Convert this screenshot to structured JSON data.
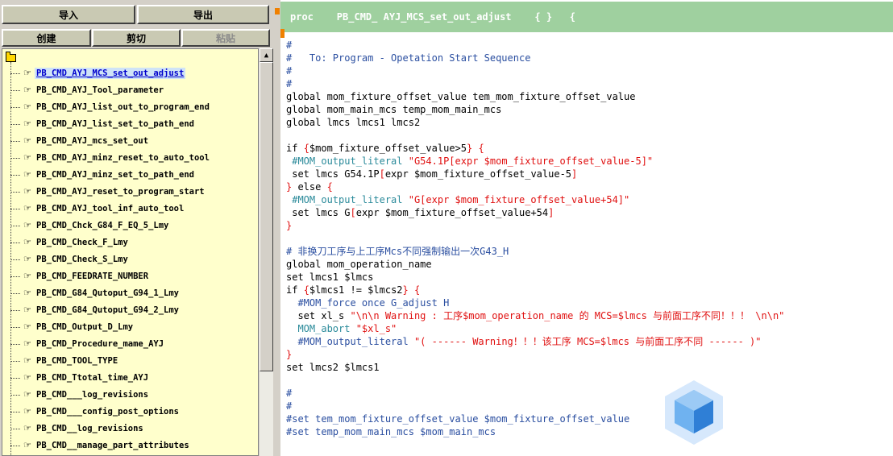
{
  "toolbar": {
    "import_label": "导入",
    "export_label": "导出",
    "create_label": "创建",
    "cut_label": "剪切",
    "paste_label": "粘贴"
  },
  "tree": {
    "items": [
      "PB_CMD_AYJ_MCS_set_out_adjust",
      "PB_CMD_AYJ_Tool_parameter",
      "PB_CMD_AYJ_list_out_to_program_end",
      "PB_CMD_AYJ_list_set_to_path_end",
      "PB_CMD_AYJ_mcs_set_out",
      "PB_CMD_AYJ_minz_reset_to_auto_tool",
      "PB_CMD_AYJ_minz_set_to_path_end",
      "PB_CMD_AYJ_reset_to_program_start",
      "PB_CMD_AYJ_tool_inf_auto_tool",
      "PB_CMD_Chck_G84_F_EQ_5_Lmy",
      "PB_CMD_Check_F_Lmy",
      "PB_CMD_Check_S_Lmy",
      "PB_CMD_FEEDRATE_NUMBER",
      "PB_CMD_G84_Qutoput_G94_1_Lmy",
      "PB_CMD_G84_Qutoput_G94_2_Lmy",
      "PB_CMD_Output_D_Lmy",
      "PB_CMD_Procedure_mame_AYJ",
      "PB_CMD_TOOL_TYPE",
      "PB_CMD_Ttotal_time_AYJ",
      "PB_CMD___log_revisions",
      "PB_CMD___config_post_options",
      "PB_CMD__log_revisions",
      "PB_CMD__manage_part_attributes"
    ],
    "selected_index": 0,
    "item_icon": "hand-pointer-icon"
  },
  "header": {
    "text": "proc    PB_CMD_ AYJ_MCS_set_out_adjust    { }   {"
  },
  "code": {
    "lines": [
      {
        "t": "#",
        "c": "cm"
      },
      {
        "t": "#   To: Program - Opetation Start Sequence",
        "c": "cm"
      },
      {
        "t": "#",
        "c": "cm"
      },
      {
        "t": "#",
        "c": "cm"
      },
      {
        "t": "global mom_fixture_offset_value tem_mom_fixture_offset_value",
        "c": "kw"
      },
      {
        "t": "global mom_main_mcs temp_mom_main_mcs",
        "c": "kw"
      },
      {
        "t": "global lmcs lmcs1 lmcs2",
        "c": "kw"
      },
      {
        "t": "",
        "c": "kw"
      },
      {
        "t": "if {$mom_fixture_offset_value>5} {",
        "c": "kw"
      },
      {
        "t": " #MOM_output_literal \"G54.1P[expr $mom_fixture_offset_value-5]\"",
        "c": "mix1"
      },
      {
        "t": " set lmcs G54.1P[expr $mom_fixture_offset_value-5]",
        "c": "mix2"
      },
      {
        "t": "} else {",
        "c": "kw"
      },
      {
        "t": " #MOM_output_literal \"G[expr $mom_fixture_offset_value+54]\"",
        "c": "mix3"
      },
      {
        "t": " set lmcs G[expr $mom_fixture_offset_value+54]",
        "c": "mix4"
      },
      {
        "t": "}",
        "c": "rd"
      },
      {
        "t": "",
        "c": "kw"
      },
      {
        "t": "# 非换刀工序与上工序Mcs不同强制输出一次G43_H",
        "c": "cm"
      },
      {
        "t": "global mom_operation_name",
        "c": "kw"
      },
      {
        "t": "set lmcs1 $lmcs",
        "c": "kw"
      },
      {
        "t": "if {$lmcs1 != $lmcs2} {",
        "c": "kw"
      },
      {
        "t": "  #MOM_force once G_adjust H",
        "c": "cm"
      },
      {
        "t": "  set xl_s \"\\n\\n Warning : 工序$mom_operation_name 的 MCS=$lmcs 与前面工序不同！！！ \\n\\n\"",
        "c": "mix5"
      },
      {
        "t": "  MOM_abort \"$xl_s\"",
        "c": "mix6"
      },
      {
        "t": "  #MOM_output_literal \"( ------ Warning！！！该工序 MCS=$lmcs 与前面工序不同 ------ )\"",
        "c": "mix7"
      },
      {
        "t": "}",
        "c": "rd"
      },
      {
        "t": "set lmcs2 $lmcs1",
        "c": "kw"
      },
      {
        "t": "",
        "c": "kw"
      },
      {
        "t": "#",
        "c": "cm"
      },
      {
        "t": "#",
        "c": "cm"
      },
      {
        "t": "#set tem_mom_fixture_offset_value $mom_fixture_offset_value",
        "c": "cm"
      },
      {
        "t": "#set temp_mom_main_mcs $mom_main_mcs",
        "c": "cm"
      }
    ]
  },
  "colors": {
    "header_bg": "#9fd09f",
    "tree_bg": "#ffffcc",
    "comment": "#2a4ea0",
    "string": "#e01010",
    "accent_marker": "#f08000"
  }
}
